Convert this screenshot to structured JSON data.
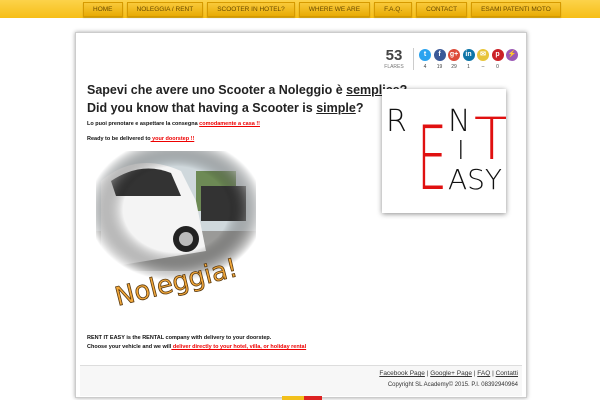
{
  "nav": [
    "HOME",
    "NOLEGGIA / RENT",
    "SCOOTER IN HOTEL?",
    "WHERE WE ARE",
    "F.A.Q.",
    "CONTACT",
    "ESAMI PATENTI MOTO"
  ],
  "share": {
    "count": "53",
    "label": "FLARES",
    "buttons": [
      {
        "icon": "twitter-icon",
        "glyph": "t",
        "color": "#2aa3ef",
        "value": "4"
      },
      {
        "icon": "facebook-icon",
        "glyph": "f",
        "color": "#3b5998",
        "value": "19"
      },
      {
        "icon": "google-plus-icon",
        "glyph": "g+",
        "color": "#dd4b39",
        "value": "29"
      },
      {
        "icon": "linkedin-icon",
        "glyph": "in",
        "color": "#0e76a8",
        "value": "1"
      },
      {
        "icon": "email-icon",
        "glyph": "✉",
        "color": "#e8c53a",
        "value": "–"
      },
      {
        "icon": "pinterest-icon",
        "glyph": "p",
        "color": "#cb2027",
        "value": "0"
      },
      {
        "icon": "flare-icon",
        "glyph": "⚡",
        "color": "#9b59b6",
        "value": ""
      }
    ]
  },
  "headline_it": {
    "pre": "Sapevi che avere uno Scooter a Noleggio è ",
    "u": "semplice",
    "post": "?"
  },
  "headline_en": {
    "pre": "Did you know that having a Scooter is ",
    "u": "simple",
    "post": "?"
  },
  "line1": {
    "text": "Lo puoi prenotare e aspettare la consegna ",
    "link": "comodamente a casa !!"
  },
  "line2": {
    "text": "Ready to be delivered to",
    "link": " your doorstep !!"
  },
  "photo_caption": "Noleggia!",
  "logo": {
    "text": "RENT IT EASY"
  },
  "bottom1": "RENT IT EASY is the RENTAL company with delivery to your doorstep.",
  "bottom2": {
    "text": "Choose your vehicle and we will",
    "link": " deliver directly to your hotel, villa, or holiday rental"
  },
  "footer": {
    "links": [
      "Facebook Page",
      "Google+ Page",
      "FAQ",
      "Contatti"
    ],
    "copyright": "Copyright SL Academy© 2015. P.I. 08392940964"
  }
}
